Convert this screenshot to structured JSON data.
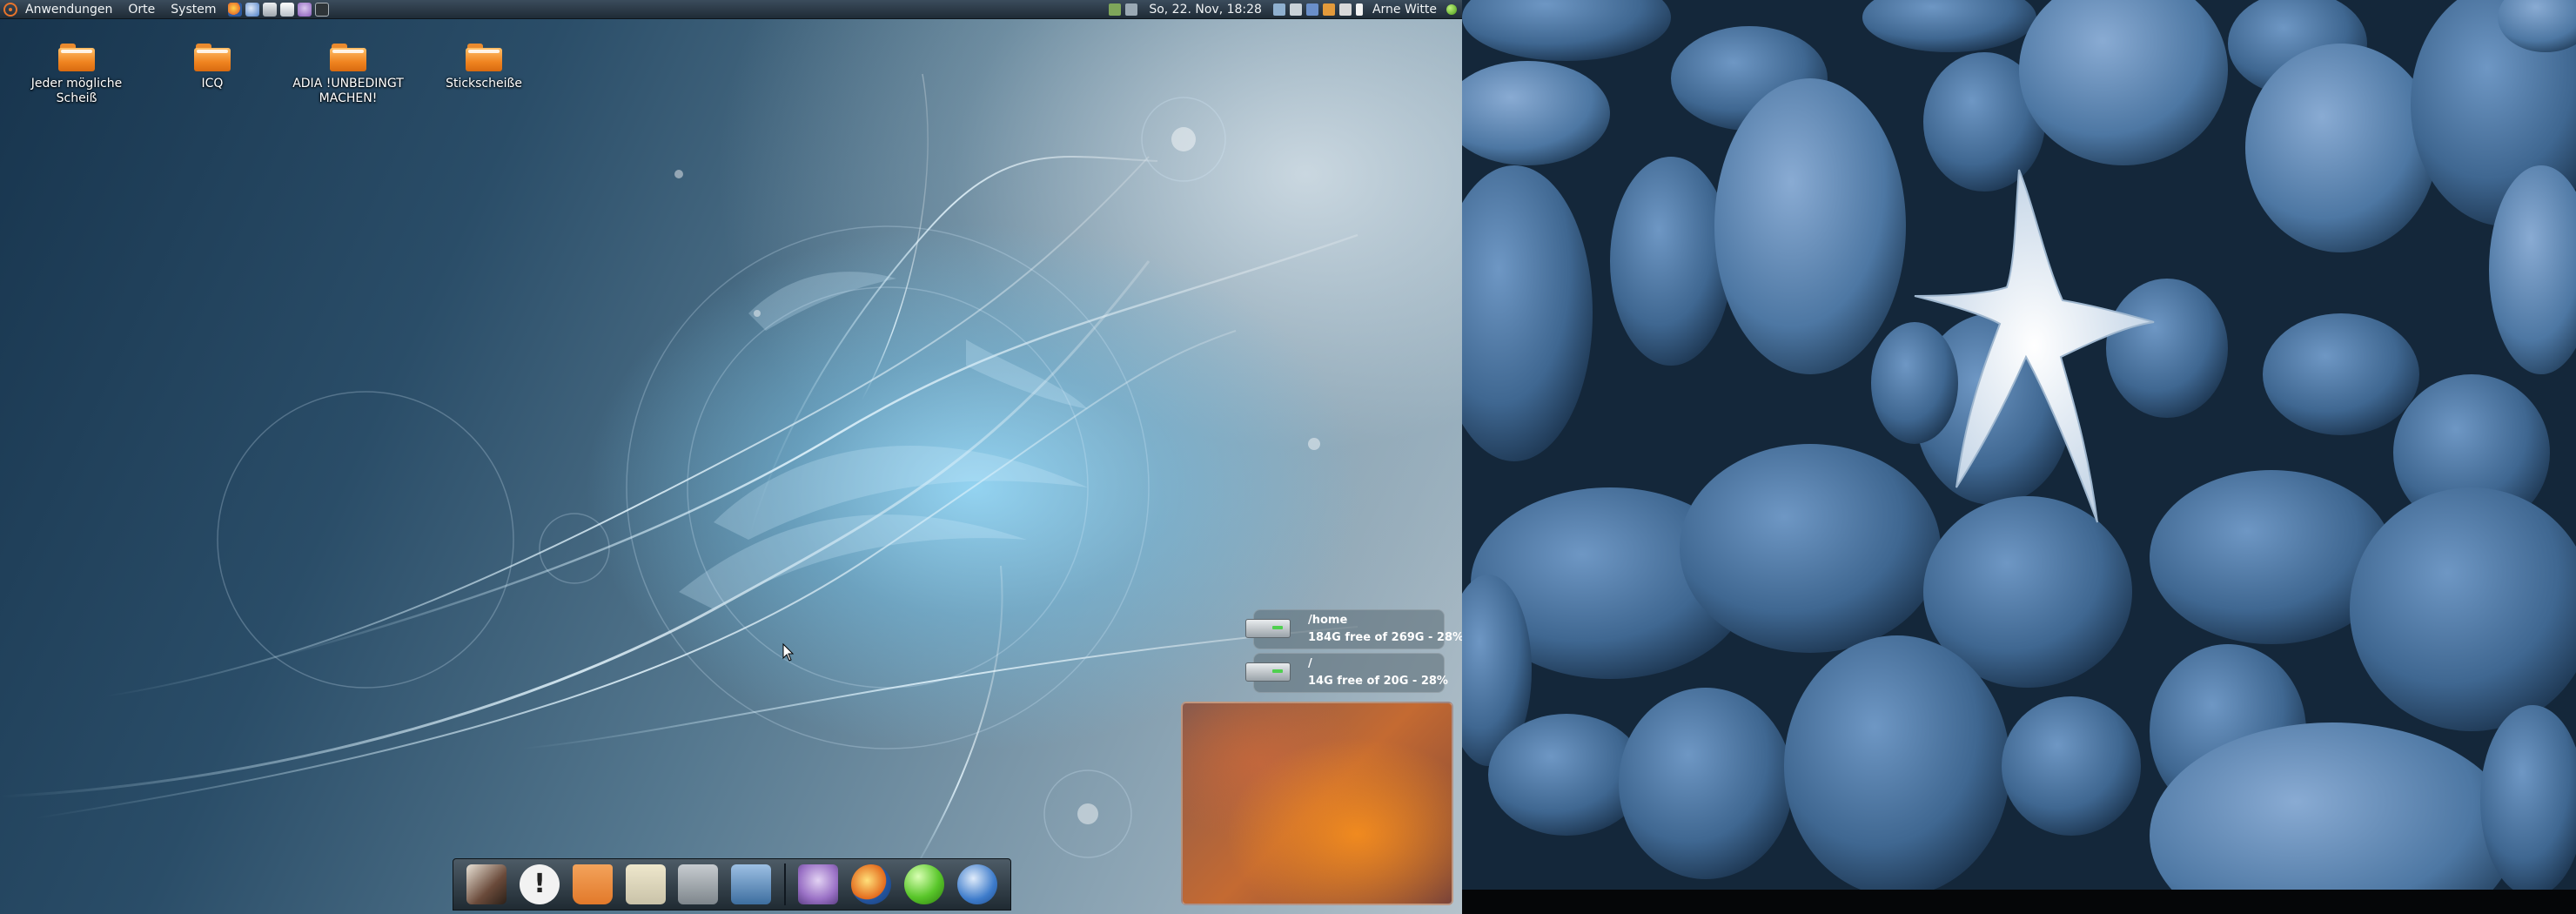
{
  "panel": {
    "menus": [
      "Anwendungen",
      "Orte",
      "System"
    ],
    "launchers": [
      {
        "icon": "firefox-icon",
        "color": "#e8742c"
      },
      {
        "icon": "thunderbird-icon",
        "color": "#4a7dc6"
      },
      {
        "icon": "printer-icon",
        "color": "#c9ced3"
      },
      {
        "icon": "home-icon",
        "color": "#d8dde2"
      },
      {
        "icon": "pidgin-icon",
        "color": "#a57ac9"
      },
      {
        "icon": "terminal-icon",
        "color": "#555f66"
      }
    ],
    "clock": "So, 22. Nov, 18:28",
    "user": "Arne Witte"
  },
  "desktop": {
    "icons": [
      {
        "label": "Jeder mögliche Scheiß"
      },
      {
        "label": "ICQ"
      },
      {
        "label": "ADIA !UNBEDINGT MACHEN!"
      },
      {
        "label": "Stickscheiße"
      }
    ]
  },
  "disks": [
    {
      "mount": "/home",
      "free_text": "184G free of 269G - 28%",
      "used_fraction": 0.28
    },
    {
      "mount": "/",
      "free_text": "14G free of 20G - 28%",
      "used_fraction": 0.28
    }
  ],
  "dock": {
    "items": [
      {
        "icon": "slideshow-icon",
        "color": "#6a4a3a"
      },
      {
        "icon": "notification-icon",
        "color": "#f2f2f2"
      },
      {
        "icon": "trash-icon",
        "color": "#e2792a"
      },
      {
        "icon": "folder-icon",
        "color": "#c9c2a8"
      },
      {
        "icon": "drawer-icon",
        "color": "#9aa1a6"
      },
      {
        "icon": "save-icon",
        "color": "#5b88b8"
      },
      {
        "icon": "pidgin-icon",
        "color": "#9b72c6"
      },
      {
        "icon": "firefox-icon",
        "color": "#e36a1c"
      },
      {
        "icon": "green-orb-icon",
        "color": "#59c62a"
      },
      {
        "icon": "thunderbird-icon",
        "color": "#3e7ccb"
      }
    ]
  }
}
